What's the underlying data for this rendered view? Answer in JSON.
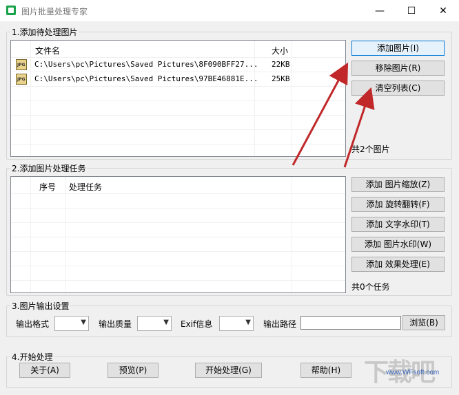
{
  "window": {
    "title": "图片批量处理专家",
    "minimize": "—",
    "maximize": "☐",
    "close": "✕"
  },
  "section1": {
    "title": "1.添加待处理图片",
    "columns": {
      "name": "文件名",
      "size": "大小"
    },
    "rows": [
      {
        "icon": "jpg-file-icon",
        "name": "C:\\Users\\pc\\Pictures\\Saved Pictures\\8F090BFF27...",
        "size": "22KB"
      },
      {
        "icon": "jpg-file-icon",
        "name": "C:\\Users\\pc\\Pictures\\Saved Pictures\\97BE46881E...",
        "size": "25KB"
      }
    ],
    "buttons": {
      "add": "添加图片(I)",
      "remove": "移除图片(R)",
      "clear": "清空列表(C)"
    },
    "count": "共2个图片"
  },
  "section2": {
    "title": "2.添加图片处理任务",
    "columns": {
      "index": "序号",
      "task": "处理任务"
    },
    "buttons": {
      "resize": "添加 图片缩放(Z)",
      "rotate": "添加 旋转翻转(F)",
      "text_watermark": "添加 文字水印(T)",
      "image_watermark": "添加 图片水印(W)",
      "effect": "添加 效果处理(E)"
    },
    "count": "共0个任务"
  },
  "section3": {
    "title": "3.图片输出设置",
    "format_label": "输出格式",
    "quality_label": "输出质量",
    "exif_label": "Exif信息",
    "path_label": "输出路径",
    "path_value": "",
    "browse": "浏览(B)"
  },
  "section4": {
    "title": "4.开始处理",
    "about": "关于(A)",
    "preview": "预览(P)",
    "start": "开始处理(G)",
    "help": "帮助(H)"
  },
  "watermark": {
    "logo": "下载吧",
    "url": "www.WFsoft.com"
  },
  "colors": {
    "arrow": "#c0282a",
    "focus_border": "#0078d7",
    "app_icon": "#1aa34a"
  }
}
